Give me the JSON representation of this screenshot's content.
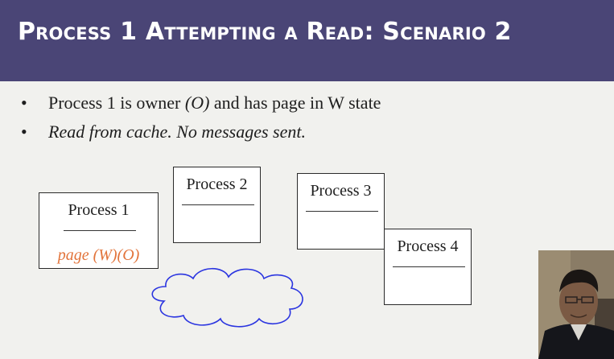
{
  "slide": {
    "title": "Process 1 Attempting a Read: Scenario 2",
    "bullets": [
      {
        "marker": "•",
        "pre": "Process 1 is owner ",
        "italic": "(O)",
        "post": " and has page in W state"
      },
      {
        "marker": "•",
        "pre": "",
        "italic": "Read from cache. No messages sent.",
        "post": ""
      }
    ]
  },
  "processes": [
    {
      "label": "Process 1",
      "note": "page (W)(O)"
    },
    {
      "label": "Process 2",
      "note": ""
    },
    {
      "label": "Process 3",
      "note": ""
    },
    {
      "label": "Process 4",
      "note": ""
    }
  ],
  "colors": {
    "title_bar": "#4a4576",
    "note_text": "#e2743b",
    "cloud_stroke": "#2b35e0"
  },
  "icons": {
    "network": "cloud-icon"
  }
}
